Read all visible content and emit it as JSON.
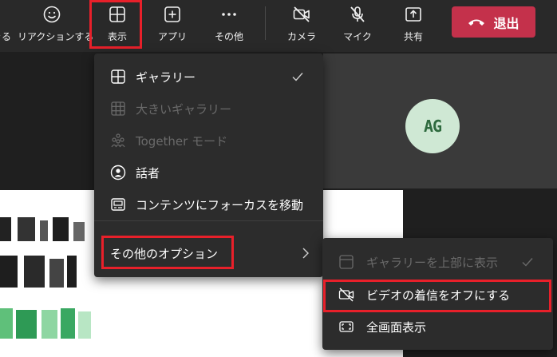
{
  "toolbar": {
    "partial_label": "ぐる",
    "reaction_label": "リアクションする",
    "view_label": "表示",
    "apps_label": "アプリ",
    "more_label": "その他",
    "camera_label": "カメラ",
    "mic_label": "マイク",
    "share_label": "共有",
    "leave_label": "退出"
  },
  "avatar": {
    "initials": "AG"
  },
  "view_menu": {
    "items": [
      {
        "label": "ギャラリー",
        "icon": "grid-icon",
        "checked": true,
        "disabled": false
      },
      {
        "label": "大きいギャラリー",
        "icon": "large-grid-icon",
        "disabled": true
      },
      {
        "label": "Together モード",
        "icon": "together-mode-icon",
        "disabled": true
      },
      {
        "label": "話者",
        "icon": "speaker-icon",
        "disabled": false
      },
      {
        "label": "コンテンツにフォーカスを移動",
        "icon": "content-focus-icon",
        "disabled": false
      }
    ],
    "more_options": {
      "label": "その他のオプション",
      "icon": "chevron-right-icon"
    }
  },
  "submenu": {
    "items": [
      {
        "label": "ギャラリーを上部に表示",
        "icon": "gallery-top-icon",
        "checked": true,
        "disabled": true
      },
      {
        "label": "ビデオの着信をオフにする",
        "icon": "video-off-icon",
        "disabled": false
      },
      {
        "label": "全画面表示",
        "icon": "fullscreen-icon",
        "disabled": false
      }
    ]
  },
  "colors": {
    "toolbar_bg": "#292929",
    "menu_bg": "#2c2c2c",
    "leave_red": "#c4314b",
    "highlight_red": "#e8202a",
    "avatar_bg": "#cfe8d4"
  }
}
